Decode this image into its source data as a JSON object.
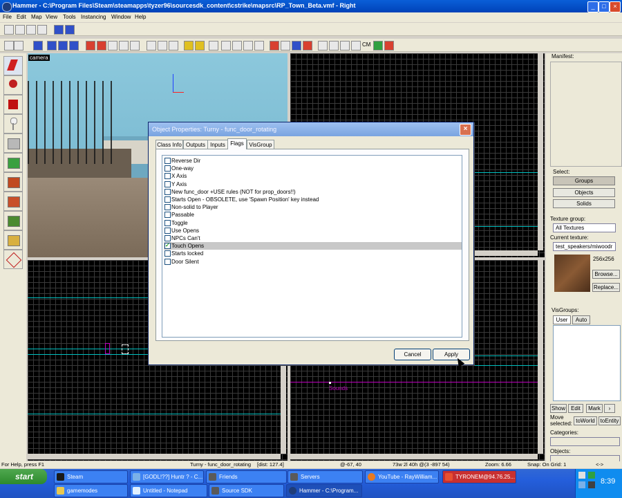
{
  "window": {
    "title": "Hammer - C:\\Program Files\\Steam\\steamapps\\tyzer96\\sourcesdk_content\\cstrike\\mapsrc\\RP_Town_Beta.vmf - Right",
    "controls": [
      "_",
      "□",
      "×"
    ]
  },
  "menu": [
    "File",
    "Edit",
    "Map",
    "View",
    "Tools",
    "Instancing",
    "Window",
    "Help"
  ],
  "toolbar": {
    "cm_label": "CM"
  },
  "viewport": {
    "camera_label": "camera",
    "entity_label": "Sounds"
  },
  "dialog": {
    "title": "Object Properties: Turny - func_door_rotating",
    "tabs": [
      "Class Info",
      "Outputs",
      "Inputs",
      "Flags",
      "VisGroup"
    ],
    "active_tab": "Flags",
    "flags": [
      {
        "label": "Reverse Dir",
        "checked": false
      },
      {
        "label": "One-way",
        "checked": false
      },
      {
        "label": "X Axis",
        "checked": false
      },
      {
        "label": "Y Axis",
        "checked": false
      },
      {
        "label": "New func_door +USE rules (NOT for prop_doors!!)",
        "checked": false
      },
      {
        "label": "Starts Open - OBSOLETE, use 'Spawn Position' key instead",
        "checked": false
      },
      {
        "label": "Non-solid to Player",
        "checked": false
      },
      {
        "label": "Passable",
        "checked": false
      },
      {
        "label": "Toggle",
        "checked": false
      },
      {
        "label": "Use Opens",
        "checked": false
      },
      {
        "label": "NPCs Can't",
        "checked": false
      },
      {
        "label": "Touch Opens",
        "checked": true
      },
      {
        "label": "Starts locked",
        "checked": false
      },
      {
        "label": "Door Silent",
        "checked": false
      }
    ],
    "cancel_label": "Cancel",
    "apply_label": "Apply"
  },
  "right_panel": {
    "manifest_label": "Manifest:",
    "select_label": "Select:",
    "groups_label": "Groups",
    "objects_label": "Objects",
    "solids_label": "Solids",
    "texture_group_label": "Texture group:",
    "texture_group_value": "All Textures",
    "current_texture_label": "Current texture:",
    "current_texture_value": "test_speakers/miwoodr",
    "texture_size": "256x256",
    "browse_label": "Browse...",
    "replace_label": "Replace...",
    "visgroups_label": "VisGroups:",
    "user_tab": "User",
    "auto_tab": "Auto",
    "show_label": "Show",
    "edit_label": "Edit",
    "mark_label": "Mark",
    "move_selected_label1": "Move",
    "move_selected_label2": "selected:",
    "toworld_label": "toWorld",
    "toentity_label": "toEntity",
    "categories_label": "Categories:",
    "objects_list_label": "Objects:"
  },
  "status": {
    "help": "For Help, press F1",
    "selection": "Turny - func_door_rotating",
    "dist": "[dist: 127.4]",
    "coords": "@-67, 40",
    "size": "73w 2l 40h @(3 -897 54)",
    "zoom": "Zoom: 6.66",
    "snap": "Snap: On Grid: 1",
    "arrow": "<->"
  },
  "taskbar": {
    "start": "start",
    "tasks_row1": [
      "Steam",
      "[GODL!??] Huntr ? - C...",
      "Friends",
      "Servers",
      "YouTube - RayWilliam...",
      "TYRONEM@94.76.25..."
    ],
    "tasks_row2": [
      "gamemodes",
      "Untitled - Notepad",
      "Source SDK",
      "Hammer - C:\\Program..."
    ],
    "clock": "8:39"
  },
  "colors": {
    "title_blue": "#0a5fd8",
    "dialog_title": "#7aa4e0",
    "grid_cyan": "#00c0c0",
    "selected_magenta": "#c000c0",
    "taskbar_blue": "#245edb"
  }
}
